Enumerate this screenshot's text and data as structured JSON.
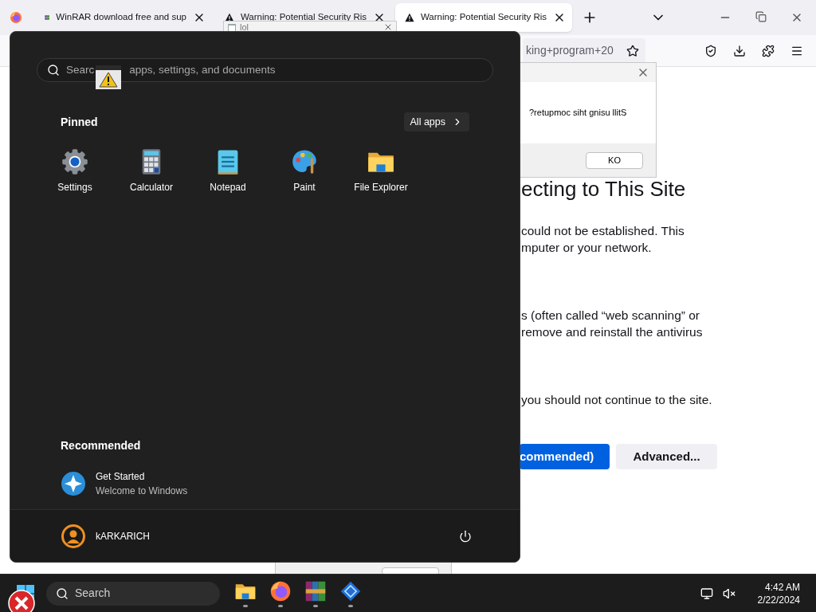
{
  "browser": {
    "tabs": [
      {
        "title": "WinRAR download free and sup",
        "selected": false
      },
      {
        "title": "Warning: Potential Security Ris",
        "selected": false
      },
      {
        "title": "Warning: Potential Security Ris",
        "selected": true
      }
    ],
    "address": "king+program+20",
    "page": {
      "heading": "ecting to This Site",
      "paragraphs": [
        [
          "could not be established. This",
          "mputer or your network."
        ],
        [
          "s (often called “web scanning” or",
          "remove and reinstall the antivirus"
        ],
        [
          "you should not continue to the site."
        ]
      ],
      "buttons": [
        {
          "label": "commended)",
          "kind": "primary"
        },
        {
          "label": "Advanced...",
          "kind": "secondary"
        }
      ]
    }
  },
  "lol_window": {
    "title": "lol"
  },
  "dialog": {
    "message": "?retupmoc siht gnisu llitS",
    "button": "KO"
  },
  "start_menu": {
    "search_placeholder": [
      "Searc",
      "apps, settings, and documents"
    ],
    "pinned_title": "Pinned",
    "all_apps": "All apps",
    "pinned": [
      {
        "label": "Settings",
        "kind": "settings"
      },
      {
        "label": "Calculator",
        "kind": "calculator"
      },
      {
        "label": "Notepad",
        "kind": "notepad"
      },
      {
        "label": "Paint",
        "kind": "paint"
      },
      {
        "label": "File Explorer",
        "kind": "explorer"
      }
    ],
    "recommended_title": "Recommended",
    "recommended": [
      {
        "title": "Get Started",
        "subtitle": "Welcome to Windows"
      }
    ],
    "user": "kARKARICH"
  },
  "taskbar": {
    "search": "Search",
    "apps": [
      {
        "kind": "explorer"
      },
      {
        "kind": "firefox"
      },
      {
        "kind": "winrar"
      },
      {
        "kind": "diamond"
      }
    ],
    "time": "4:42 AM",
    "date": "2/22/2024"
  }
}
